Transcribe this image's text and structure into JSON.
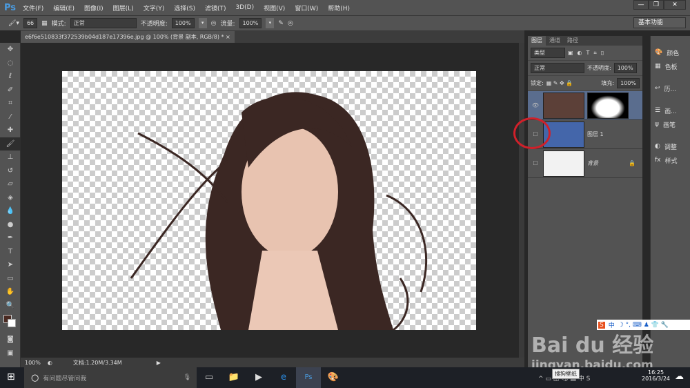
{
  "app": {
    "logo": "Ps",
    "menu": [
      "文件(F)",
      "编辑(E)",
      "图像(I)",
      "图层(L)",
      "文字(Y)",
      "选择(S)",
      "滤镜(T)",
      "3D(D)",
      "视图(V)",
      "窗口(W)",
      "帮助(H)"
    ],
    "window_controls": [
      "—",
      "❐",
      "✕"
    ]
  },
  "options": {
    "brush_size": "66",
    "mode_label": "模式:",
    "mode_value": "正常",
    "opacity_label": "不透明度:",
    "opacity_value": "100%",
    "flow_label": "流量:",
    "flow_value": "100%",
    "workspace": "基本功能"
  },
  "document": {
    "tab_title": "e6f6e510833f372539b04d187e17396e.jpg @ 100% (背景 副本, RGB/8) *",
    "close": "×",
    "zoom": "100%",
    "doc_info": "文档:1.20M/3.34M"
  },
  "layers_panel": {
    "tabs": [
      "图层",
      "通道",
      "路径"
    ],
    "filter": "类型",
    "blend": "正常",
    "opacity_label": "不透明度:",
    "opacity": "100%",
    "lock_label": "锁定:",
    "fill_label": "填充:",
    "fill": "100%",
    "layers": [
      {
        "name": "",
        "visible": true,
        "thumb_color": "#5c4038"
      },
      {
        "name": "图层 1",
        "visible": false,
        "thumb_color": "#4466aa"
      },
      {
        "name": "背景",
        "visible": false,
        "thumb_color": "#f2f2f2"
      }
    ]
  },
  "side_panel": [
    "颜色",
    "色板",
    "历...",
    "画...",
    "画笔",
    "调整",
    "样式"
  ],
  "taskbar": {
    "search_placeholder": "有问题尽管问我",
    "time": "16:25",
    "date": "2016/3/24",
    "tooltip": "搜狗壁纸",
    "ime_lang": "中"
  },
  "watermark": {
    "line1": "Bai du 经验",
    "line2": "jingyan.baidu.com"
  }
}
